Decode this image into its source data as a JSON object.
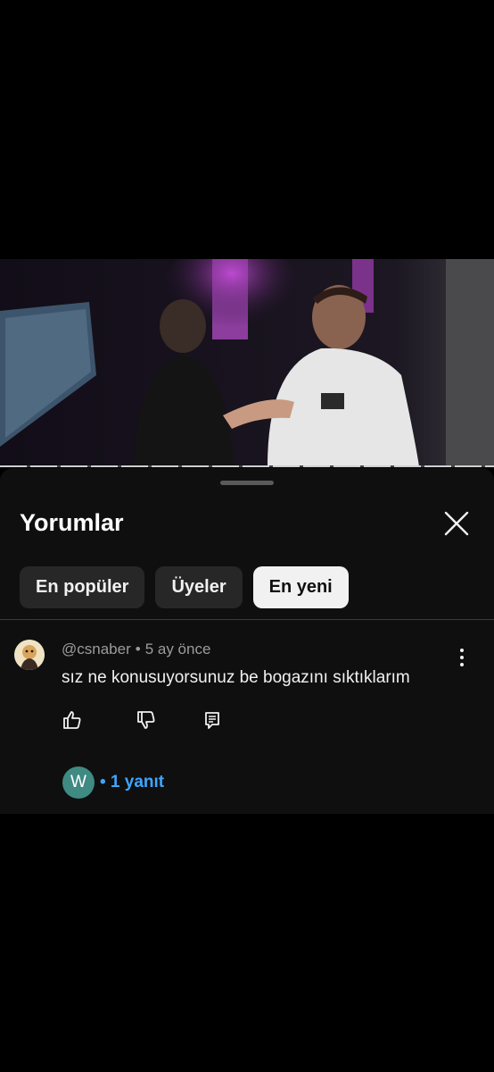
{
  "sheet": {
    "title": "Yorumlar",
    "close_icon": "close-icon"
  },
  "filters": [
    {
      "label": "En popüler",
      "active": false
    },
    {
      "label": "Üyeler",
      "active": false
    },
    {
      "label": "En yeni",
      "active": true
    }
  ],
  "comment": {
    "author": "@csnaber",
    "separator": "•",
    "time": "5 ay önce",
    "text": "sız ne konusuyorsunuz be bogazını sıktıklarım",
    "actions": [
      "like-icon",
      "dislike-icon",
      "reply-icon"
    ],
    "reply_avatar_letter": "W",
    "reply_count_label": "• 1 yanıt"
  },
  "colors": {
    "background": "#0f0f0f",
    "chip": "#272727",
    "chip_active": "#f1f1f1",
    "link": "#3ea6ff",
    "reply_avatar": "#3f8a83"
  }
}
